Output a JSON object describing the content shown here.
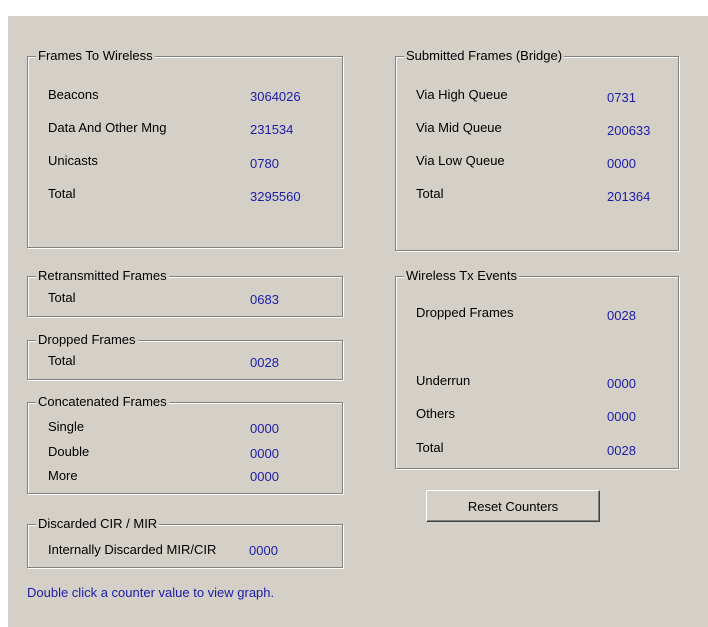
{
  "frames_to_wireless": {
    "title": "Frames To Wireless",
    "rows": [
      {
        "label": "Beacons",
        "value": "3064026"
      },
      {
        "label": "Data And Other Mng",
        "value": "231534"
      },
      {
        "label": "Unicasts",
        "value": "0780"
      },
      {
        "label": "Total",
        "value": "3295560"
      }
    ]
  },
  "submitted_frames": {
    "title": "Submitted Frames (Bridge)",
    "rows": [
      {
        "label": "Via High Queue",
        "value": "0731"
      },
      {
        "label": "Via Mid Queue",
        "value": "200633"
      },
      {
        "label": "Via Low Queue",
        "value": "0000"
      },
      {
        "label": "Total",
        "value": "201364"
      }
    ]
  },
  "retransmitted_frames": {
    "title": "Retransmitted Frames",
    "rows": [
      {
        "label": "Total",
        "value": "0683"
      }
    ]
  },
  "dropped_frames": {
    "title": "Dropped Frames",
    "rows": [
      {
        "label": "Total",
        "value": "0028"
      }
    ]
  },
  "concatenated_frames": {
    "title": "Concatenated Frames",
    "rows": [
      {
        "label": "Single",
        "value": "0000"
      },
      {
        "label": "Double",
        "value": "0000"
      },
      {
        "label": "More",
        "value": "0000"
      }
    ]
  },
  "discarded": {
    "title": "Discarded CIR / MIR",
    "rows": [
      {
        "label": "Internally Discarded MIR/CIR",
        "value": "0000"
      }
    ]
  },
  "wireless_tx_events": {
    "title": "Wireless Tx Events",
    "rows": [
      {
        "label": "Dropped Frames",
        "value": "0028"
      },
      {
        "label": "Underrun",
        "value": "0000"
      },
      {
        "label": "Others",
        "value": "0000"
      },
      {
        "label": "Total",
        "value": "0028"
      }
    ]
  },
  "reset_button_label": "Reset Counters",
  "hint_text": "Double click a counter value to view graph."
}
